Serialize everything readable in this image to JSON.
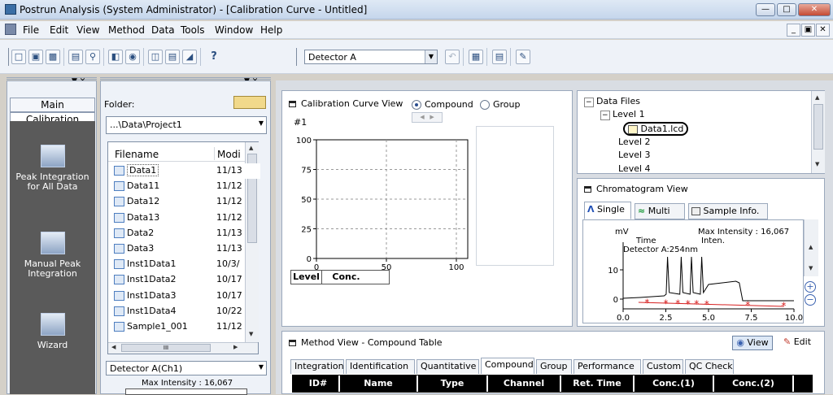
{
  "window": {
    "title": "Postrun Analysis (System Administrator) - [Calibration Curve - Untitled]"
  },
  "menu": {
    "items": [
      "File",
      "Edit",
      "View",
      "Method",
      "Data",
      "Tools",
      "Window",
      "Help"
    ]
  },
  "toolbar": {
    "detector": "Detector A",
    "help_label": "?"
  },
  "assistant_bar": {
    "tabs": [
      "Main",
      "Calibration"
    ],
    "active_tab": "Calibration",
    "items": [
      {
        "label": "Peak Integration for All Data",
        "icon": "peak-integration-icon"
      },
      {
        "label": "Manual Peak Integration",
        "icon": "manual-integration-icon"
      },
      {
        "label": "Wizard",
        "icon": "wizard-icon"
      }
    ]
  },
  "data_explorer": {
    "folder_label": "Folder:",
    "folder_path": "...\\Data\\Project1",
    "columns": [
      "Filename",
      "Modi"
    ],
    "files": [
      {
        "name": "Data1",
        "date": "11/13"
      },
      {
        "name": "Data11",
        "date": "11/12"
      },
      {
        "name": "Data12",
        "date": "11/12"
      },
      {
        "name": "Data13",
        "date": "11/12"
      },
      {
        "name": "Data2",
        "date": "11/13"
      },
      {
        "name": "Data3",
        "date": "11/13"
      },
      {
        "name": "Inst1Data1",
        "date": "10/3/"
      },
      {
        "name": "Inst1Data2",
        "date": "10/17"
      },
      {
        "name": "Inst1Data3",
        "date": "10/17"
      },
      {
        "name": "Inst1Data4",
        "date": "10/22"
      },
      {
        "name": "Sample1_001",
        "date": "11/12"
      }
    ],
    "hscroll_thumb": "III",
    "detector_select": "Detector A(Ch1)",
    "max_intensity": "Max Intensity : 16,067"
  },
  "calibration_view": {
    "title": "Calibration Curve View",
    "radio_compound": "Compound",
    "radio_group": "Group",
    "selected": "Compound",
    "compound_index": "#1",
    "y_ticks": [
      "100",
      "75",
      "50",
      "25",
      "0"
    ],
    "x_ticks": [
      "0",
      "50",
      "100"
    ],
    "table_headers": [
      "Level",
      "Conc."
    ]
  },
  "data_files_tree": {
    "root": "Data Files",
    "levels": [
      "Level 1",
      "Level 2",
      "Level 3",
      "Level 4"
    ],
    "file": "Data1.lcd"
  },
  "chromatogram_view": {
    "title": "Chromatogram View",
    "tabs": [
      "Single",
      "Multi",
      "Sample Info."
    ],
    "active_tab": "Single",
    "y_unit": "mV",
    "max_intensity": "Max Intensity : 16,067",
    "col_time": "Time",
    "col_inten": "Inten.",
    "detector_label": "Detector A:254nm",
    "y_ticks": [
      "10",
      "0"
    ],
    "x_ticks": [
      "0.0",
      "2.5",
      "5.0",
      "7.5",
      "10.0"
    ]
  },
  "method_view": {
    "title": "Method View - Compound Table",
    "view_button": "View",
    "edit_button": "Edit",
    "tabs": [
      "Integration",
      "Identification",
      "Quantitative",
      "Compound",
      "Group",
      "Performance",
      "Custom",
      "QC Check"
    ],
    "active_tab": "Compound",
    "columns": [
      "ID#",
      "Name",
      "Type",
      "Channel",
      "Ret. Time",
      "Conc.(1)",
      "Conc.(2)"
    ]
  }
}
